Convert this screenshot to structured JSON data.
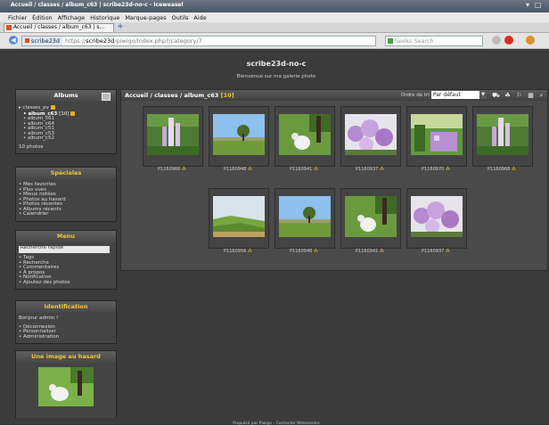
{
  "window": {
    "title": "Accueil / classes / album_c63 | scribe23d-no-c - Iceweasel"
  },
  "menubar": [
    {
      "id": "menu-fichier",
      "label": "Fichier"
    },
    {
      "id": "menu-edition",
      "label": "Édition"
    },
    {
      "id": "menu-affichage",
      "label": "Affichage"
    },
    {
      "id": "menu-historique",
      "label": "Historique"
    },
    {
      "id": "menu-marque-pages",
      "label": "Marque-pages"
    },
    {
      "id": "menu-outils",
      "label": "Outils"
    },
    {
      "id": "menu-aide",
      "label": "Aide"
    }
  ],
  "tab": {
    "title": "Accueil / classes / album_c63 | s..."
  },
  "address": {
    "site": "scribe23d",
    "prefix": "https://",
    "host": "scribe23d",
    "path": "/piwigo/index.php?/category/7"
  },
  "search": {
    "placeholder": "Seeks Search"
  },
  "site": {
    "title": "scribe23d-no-c",
    "subtitle": "Bienvenue sur ma galerie photo"
  },
  "albums": {
    "header": "Albums",
    "items": [
      {
        "label": "classes_pv",
        "count": ""
      },
      {
        "label": "album_c63",
        "count": "[10]"
      },
      {
        "label": "album_c61",
        "count": ""
      },
      {
        "label": "album_c64",
        "count": ""
      },
      {
        "label": "album_c51",
        "count": ""
      },
      {
        "label": "album_c53",
        "count": ""
      },
      {
        "label": "album_c52",
        "count": ""
      }
    ],
    "photo_count": "10 photos"
  },
  "speciales": {
    "header": "Spéciales",
    "items": [
      "Mes favorites",
      "Plus vues",
      "Mieux notées",
      "Photos au hasard",
      "Photos récentes",
      "Albums récents",
      "Calendrier"
    ]
  },
  "menu": {
    "header": "Menu",
    "search_placeholder": "Recherche rapide",
    "items": [
      "Tags",
      "Recherche",
      "Commentaires",
      "À propos",
      "Notification",
      "Ajoutez des photos"
    ]
  },
  "identification": {
    "header": "Identification",
    "greeting": "Bonjour admin !",
    "items": [
      "Déconnexion",
      "Personnaliser",
      "Administration"
    ]
  },
  "random": {
    "header": "Une image au hasard"
  },
  "content": {
    "breadcrumb": "Accueil / classes / album_c63",
    "count": "[10]",
    "sort_label": "Ordre de tri",
    "sort_value": "Par défaut"
  },
  "thumbs": [
    {
      "label": "P1160966",
      "kind": "flowers"
    },
    {
      "label": "P1160948",
      "kind": "tree"
    },
    {
      "label": "P1160941",
      "kind": "dog"
    },
    {
      "label": "P1160937",
      "kind": "lilac"
    },
    {
      "label": "P1160970",
      "kind": "garden"
    },
    {
      "label": "P1160968",
      "kind": "flowers"
    },
    {
      "label": "P1160956",
      "kind": "hills"
    },
    {
      "label": "P1160948",
      "kind": "tree"
    },
    {
      "label": "P1160941",
      "kind": "dog"
    },
    {
      "label": "P1160937",
      "kind": "lilac"
    }
  ],
  "footer": "Propulsé par Piwigo - Contacter Webmestre"
}
